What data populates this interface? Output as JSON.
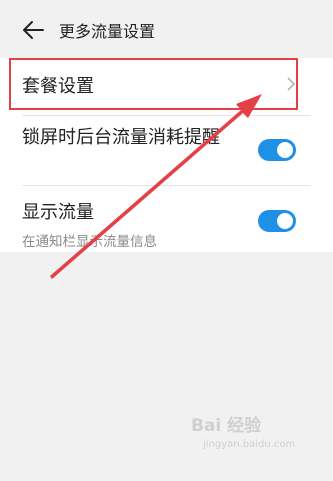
{
  "header": {
    "back_icon": "arrow-left-icon",
    "title": "更多流量设置"
  },
  "rows": [
    {
      "label": "套餐设置",
      "trailing_icon": "chevron-right-icon"
    },
    {
      "label": "锁屏时后台流量消耗提醒",
      "toggle_on": true
    },
    {
      "label": "显示流量",
      "sublabel": "在通知栏显示流量信息",
      "toggle_on": true
    }
  ],
  "colors": {
    "accent": "#1e90e6",
    "highlight": "#e53f48",
    "background": "#f1f1f1"
  },
  "watermark": {
    "text": "Bai 经验",
    "url": "jingyan.baidu.com"
  }
}
